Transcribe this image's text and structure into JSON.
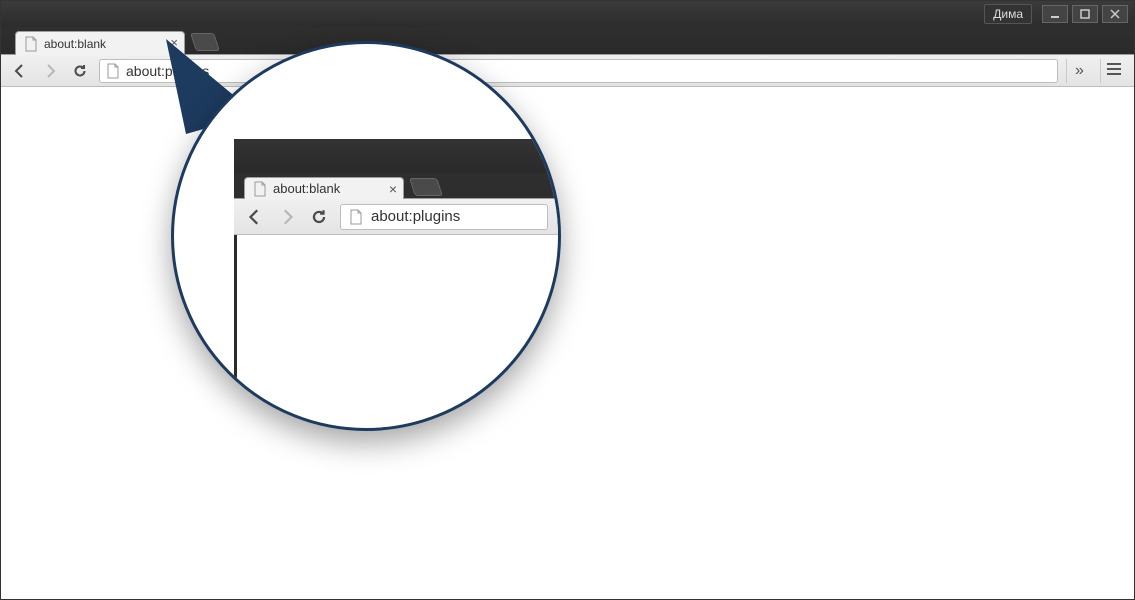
{
  "window": {
    "user_label": "Дима"
  },
  "tabs": {
    "active": {
      "title": "about:blank"
    }
  },
  "toolbar": {
    "url": "about:plugins",
    "overflow_label": "»"
  },
  "magnifier": {
    "tab_title": "about:blank",
    "url": "about:plugins"
  }
}
